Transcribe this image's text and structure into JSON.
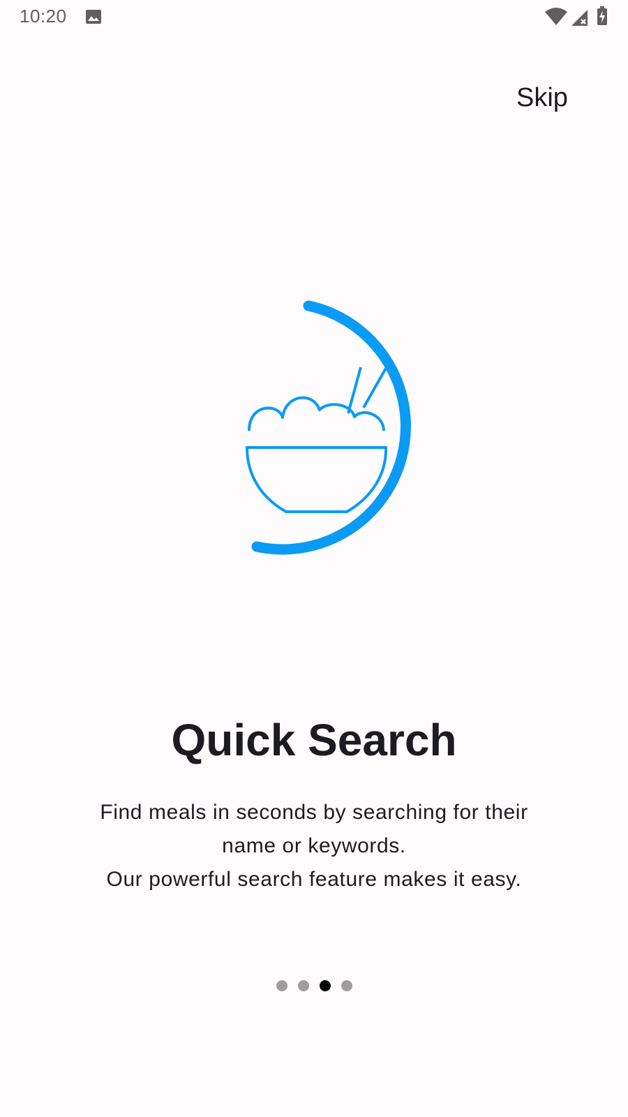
{
  "status_bar": {
    "time": "10:20",
    "icons": [
      "gallery-icon",
      "wifi-icon",
      "signal-icon",
      "battery-charging-icon"
    ]
  },
  "header": {
    "skip_label": "Skip"
  },
  "illustration": {
    "icon": "rice-bowl-icon",
    "accent_color": "#0A9BF5"
  },
  "onboarding": {
    "title": "Quick Search",
    "description_lines": [
      "Find meals in seconds by searching for their",
      "name or keywords.",
      "Our powerful search feature makes it easy."
    ]
  },
  "pager": {
    "page_count": 4,
    "current_page": 3,
    "active_color": "#000000",
    "inactive_color": "#9E9E9E"
  }
}
